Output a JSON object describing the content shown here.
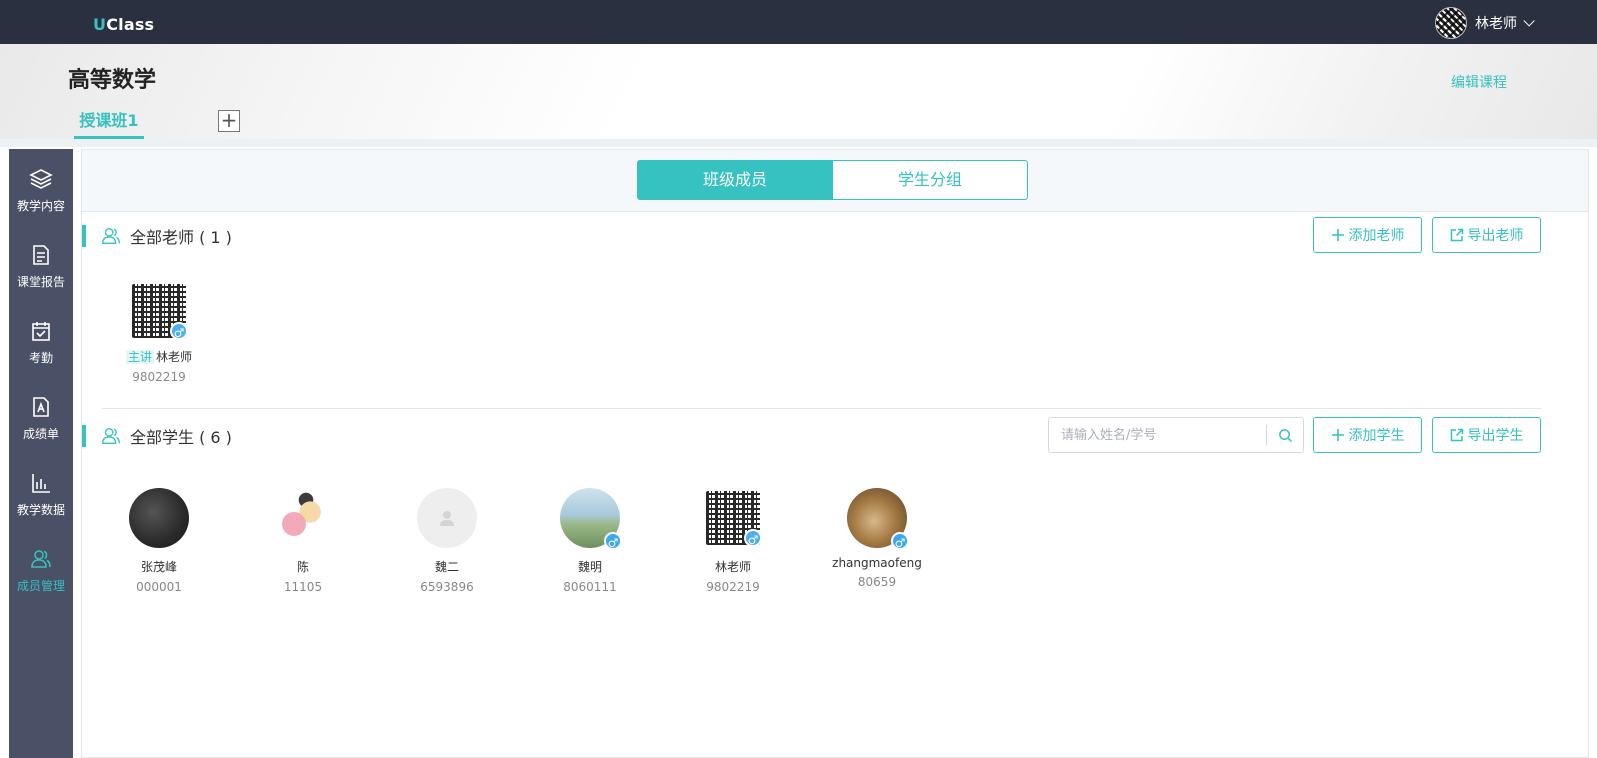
{
  "brand": {
    "logo_u": "U",
    "logo_rest": "Class"
  },
  "user": {
    "name": "林老师"
  },
  "course": {
    "title": "高等数学",
    "edit_label": "编辑课程",
    "class_tab": "授课班1",
    "add_class_symbol": "+"
  },
  "sidebar": {
    "items": [
      {
        "label": "教学内容",
        "icon": "layers-icon"
      },
      {
        "label": "课堂报告",
        "icon": "document-icon"
      },
      {
        "label": "考勤",
        "icon": "calendar-check-icon"
      },
      {
        "label": "成绩单",
        "icon": "grade-report-icon"
      },
      {
        "label": "教学数据",
        "icon": "bar-chart-icon"
      },
      {
        "label": "成员管理",
        "icon": "users-icon",
        "active": true
      }
    ]
  },
  "segments": {
    "members": "班级成员",
    "groups": "学生分组"
  },
  "teachers": {
    "title": "全部老师 ( 1 )",
    "add_label": "添加老师",
    "export_label": "导出老师",
    "list": [
      {
        "role": "主讲",
        "name": "林老师",
        "id": "9802219",
        "gender": "♂"
      }
    ]
  },
  "students": {
    "title": "全部学生 ( 6 )",
    "search_placeholder": "请输入姓名/学号",
    "add_label": "添加学生",
    "export_label": "导出学生",
    "list": [
      {
        "name": "张茂峰",
        "id": "000001"
      },
      {
        "name": "陈",
        "id": "11105"
      },
      {
        "name": "魏二",
        "id": "6593896"
      },
      {
        "name": "魏明",
        "id": "8060111",
        "gender": "♂"
      },
      {
        "name": "林老师",
        "id": "9802219",
        "gender": "♂"
      },
      {
        "name": "zhangmaofeng",
        "id": "80659",
        "gender": "♂"
      }
    ]
  },
  "colors": {
    "accent": "#36c2c0",
    "topbar": "#2b3040",
    "sidebar": "#4a5065",
    "gender_badge": "#3aa7f0"
  }
}
